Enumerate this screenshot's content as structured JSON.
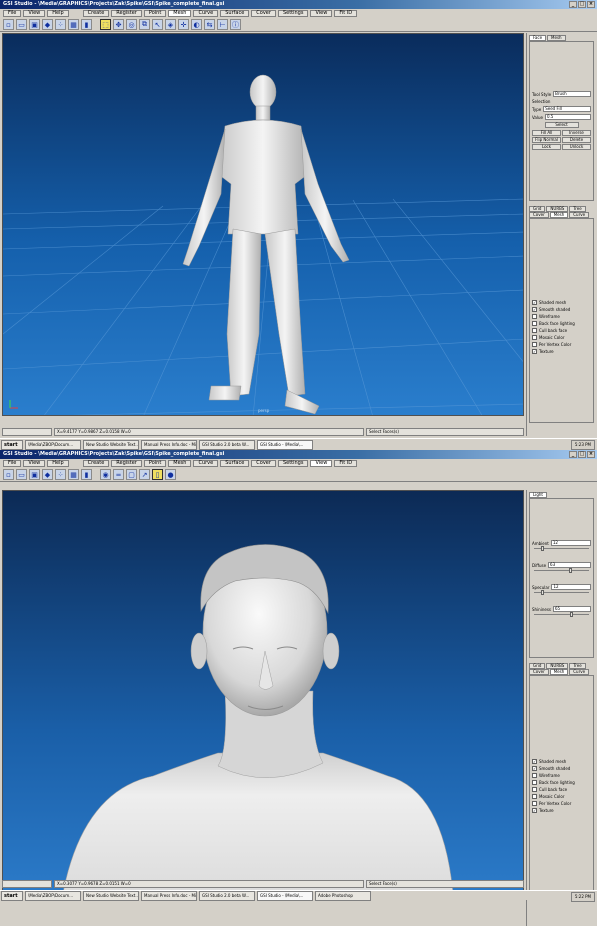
{
  "shot1": {
    "title": "GSI Studio - \\Media\\GRAPHICS\\Projects\\Zak\\Spike\\GSI\\Spike_complete_final.gsi",
    "menu": [
      "File",
      "View",
      "Help",
      "Create",
      "Register",
      "Point",
      "Mesh",
      "Curve",
      "Surface",
      "Cover",
      "Settings",
      "View",
      "Fit ID"
    ],
    "active_menu": 6,
    "viewport_label": "persp",
    "panel_tabs": [
      "Face",
      "Mesh"
    ],
    "tool_style_label": "Tool Style",
    "tool_style_value": "Brush",
    "selection_heading": "Selection",
    "type_label": "Type",
    "type_value": "Seed Fill",
    "value_label": "Value",
    "value_value": "0.5",
    "select_button": "Select",
    "action_buttons": [
      "Fill All",
      "Inverse",
      "Flip Normal",
      "Delete",
      "Lock",
      "Unlock"
    ],
    "lower_tabs_top": [
      "Grid",
      "NURBS",
      "Tree"
    ],
    "lower_tabs_bottom": [
      "Cover",
      "Mesh",
      "Curve"
    ],
    "options": [
      {
        "label": "Shaded mesh",
        "checked": true
      },
      {
        "label": "Smooth shaded",
        "checked": true
      },
      {
        "label": "Wireframe",
        "checked": false
      },
      {
        "label": "Back face lighting",
        "checked": false
      },
      {
        "label": "Cull back face",
        "checked": false
      },
      {
        "label": "Mosaic Color",
        "checked": false
      },
      {
        "label": "Per Vertex Color",
        "checked": false
      },
      {
        "label": "Texture",
        "checked": true
      }
    ],
    "status_left": "X=9.4177 Y=0.9867 Z=0.0158 W=0",
    "status_right": "Select Faces(s)",
    "taskbar": [
      "\\Media\\ZBOP\\Docum...",
      "New Studio Website Text...",
      "Manual Press Info.doc - Mi...",
      "GSI Studio 2.0 beta W...",
      "GSI Studio - \\Media\\..."
    ],
    "active_task": 4,
    "clock": "5:23 PM"
  },
  "shot2": {
    "title": "GSI Studio - \\Media\\GRAPHICS\\Projects\\Zak\\Spike\\GSI\\Spike_complete_final.gsi",
    "menu": [
      "File",
      "View",
      "Help",
      "Create",
      "Register",
      "Point",
      "Mesh",
      "Curve",
      "Surface",
      "Cover",
      "Settings",
      "View",
      "Fit ID"
    ],
    "active_menu": 11,
    "panel_tabs": [
      "Light"
    ],
    "sliders": [
      {
        "label": "Ambient",
        "value": "12",
        "level": 0.12
      },
      {
        "label": "Diffuse",
        "value": "63",
        "level": 0.63
      },
      {
        "label": "Specular",
        "value": "12",
        "level": 0.12
      },
      {
        "label": "Shininess",
        "value": "65",
        "level": 0.65
      }
    ],
    "lower_tabs_top": [
      "Grid",
      "NURBS",
      "Tree"
    ],
    "lower_tabs_bottom": [
      "Cover",
      "Mesh",
      "Curve"
    ],
    "options": [
      {
        "label": "Shaded mesh",
        "checked": true
      },
      {
        "label": "Smooth shaded",
        "checked": true
      },
      {
        "label": "Wireframe",
        "checked": false
      },
      {
        "label": "Back face lighting",
        "checked": false
      },
      {
        "label": "Cull back face",
        "checked": false
      },
      {
        "label": "Mosaic Color",
        "checked": false
      },
      {
        "label": "Per Vertex Color",
        "checked": false
      },
      {
        "label": "Texture",
        "checked": true
      }
    ],
    "status_left": "X=0.3077 Y=0.9678 Z=0.0151 W=0",
    "status_right": "Select Face(s)",
    "taskbar": [
      "\\Media\\ZBOP\\Docum...",
      "New Studio Website Text...",
      "Manual Press Info.doc - Mi...",
      "GSI Studio 2.0 beta W...",
      "GSI Studio - \\Media\\...",
      "Adobe Photoshop"
    ],
    "active_task": 4,
    "clock": "5:22 PM"
  },
  "start_label": "start",
  "icons": {
    "toolbar1": [
      "new-icon",
      "open-icon",
      "save-icon",
      "cube-icon",
      "points-icon",
      "mesh-icon",
      "layer-icon",
      "select-icon",
      "pan-icon",
      "orbit-icon",
      "fit-icon",
      "pick-icon",
      "light-icon",
      "move-icon",
      "mirror-icon",
      "flip-icon",
      "measure-icon",
      "info-icon"
    ],
    "toolbar2": [
      "new-icon",
      "open-icon",
      "save-icon",
      "cube-icon",
      "points-icon",
      "mesh-icon",
      "layer-icon",
      "camera-icon",
      "ruler-icon",
      "frame-icon",
      "cursor-icon",
      "bulb-icon",
      "sphere-icon"
    ]
  }
}
